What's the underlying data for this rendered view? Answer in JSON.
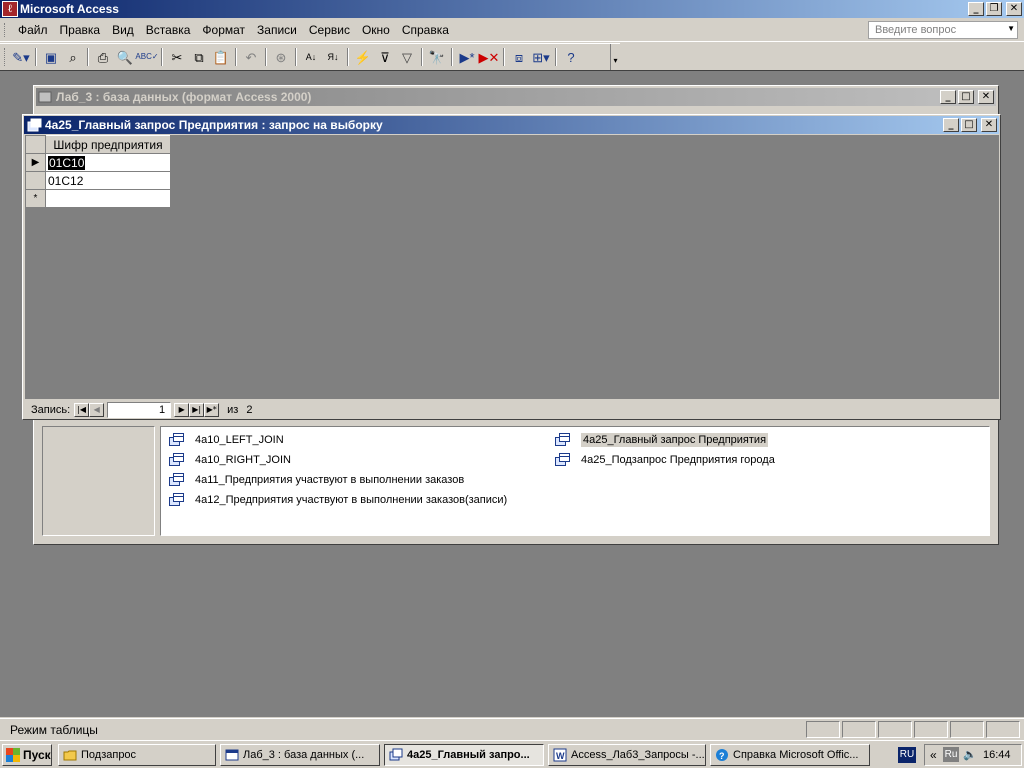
{
  "app": {
    "title": "Microsoft Access"
  },
  "menu": {
    "items": [
      "Файл",
      "Правка",
      "Вид",
      "Вставка",
      "Формат",
      "Записи",
      "Сервис",
      "Окно",
      "Справка"
    ],
    "ask_placeholder": "Введите вопрос"
  },
  "toolbar": {
    "icons": [
      "design-view-icon",
      "save-icon",
      "search-icon",
      "print-icon",
      "print-preview-icon",
      "spelling-icon",
      "cut-icon",
      "copy-icon",
      "paste-icon",
      "undo-icon",
      "hyperlink-icon",
      "sort-ascending-icon",
      "sort-descending-icon",
      "filter-by-selection-icon",
      "filter-by-form-icon",
      "apply-filter-icon",
      "find-icon",
      "new-record-icon",
      "delete-record-icon",
      "database-window-icon",
      "new-object-icon",
      "help-icon"
    ]
  },
  "db_window": {
    "title": "Лаб_3 : база данных (формат Access 2000)",
    "queries": [
      {
        "label": "4a10_LEFT_JOIN"
      },
      {
        "label": "4a10_RIGHT_JOIN"
      },
      {
        "label": "4a11_Предприятия участвуют в выполнении заказов"
      },
      {
        "label": "4a12_Предприятия участвуют в выполнении заказов(записи)"
      },
      {
        "label": "4a25_Главный запрос Предприятия"
      },
      {
        "label": "4a25_Подзапрос Предприятия города"
      }
    ]
  },
  "query_window": {
    "title": "4a25_Главный запрос Предприятия : запрос на выборку",
    "column_header": "Шифр предприятия",
    "rows": [
      "01С10",
      "01С12"
    ],
    "new_row_marker": "*",
    "current_row_marker": "▶",
    "nav": {
      "label": "Запись:",
      "current": "1",
      "of_label": "из",
      "total": "2"
    }
  },
  "status": {
    "text": "Режим таблицы"
  },
  "taskbar": {
    "start": "Пуск",
    "tasks": [
      {
        "label": "Подзапрос"
      },
      {
        "label": "Лаб_3 : база данных (..."
      },
      {
        "label": "4a25_Главный запро..."
      },
      {
        "label": "Access_Лаб3_Запросы -..."
      },
      {
        "label": "Справка Microsoft Offic..."
      }
    ],
    "lang": "RU",
    "tray_lang": "Ru",
    "clock": "16:44"
  }
}
